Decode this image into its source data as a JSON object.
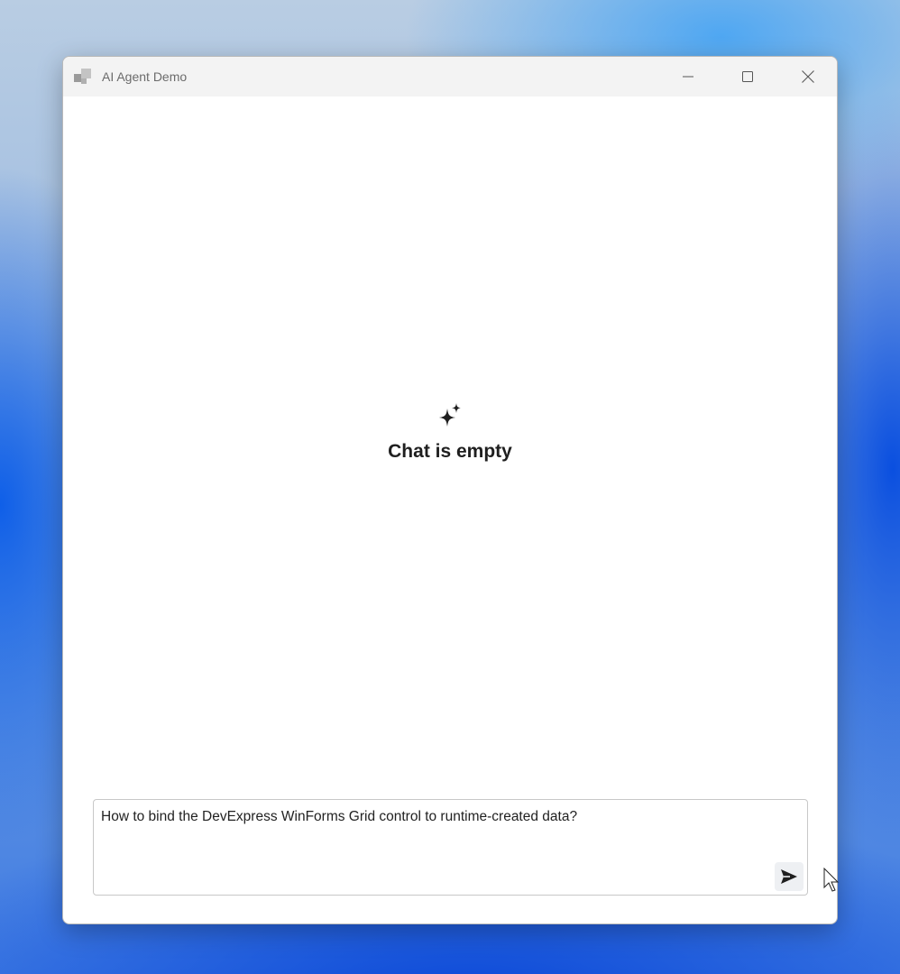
{
  "window": {
    "title": "AI Agent Demo",
    "controls": {
      "minimize_icon": "minimize-icon",
      "maximize_icon": "maximize-icon",
      "close_icon": "close-icon"
    }
  },
  "chat": {
    "empty_icon": "sparkle-icon",
    "empty_text": "Chat is empty"
  },
  "composer": {
    "input_value": "How to bind the DevExpress WinForms Grid control to runtime-created data?",
    "send_icon": "send-icon"
  },
  "colors": {
    "titlebar_bg": "#f3f3f3",
    "window_bg": "#ffffff",
    "title_text": "#6b6b6b",
    "empty_text": "#1f1f1f",
    "send_button_bg": "#eef0f3"
  }
}
